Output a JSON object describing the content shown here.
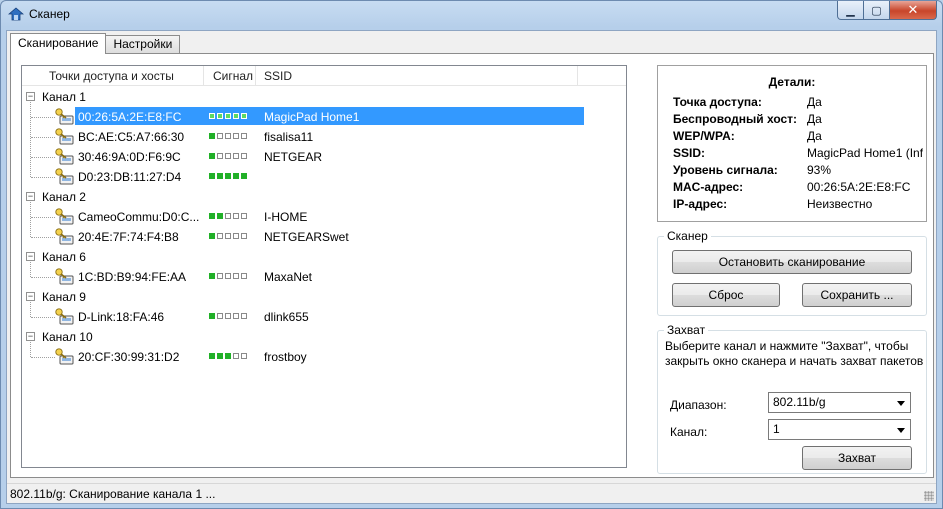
{
  "window": {
    "title": "Сканер",
    "controls": {
      "minimize_icon": "minimize-icon",
      "maximize_icon": "maximize-icon",
      "close_icon": "close-icon"
    }
  },
  "tabs": [
    {
      "label": "Сканирование",
      "active": true
    },
    {
      "label": "Настройки",
      "active": false
    }
  ],
  "tree": {
    "columns": [
      "Точки доступа и хосты",
      "Сигнал",
      "SSID"
    ],
    "channels": [
      {
        "label": "Канал 1",
        "hosts": [
          {
            "mac": "00:26:5A:2E:E8:FC",
            "signal": 5,
            "ssid": "MagicPad Home1",
            "selected": true
          },
          {
            "mac": "BC:AE:C5:A7:66:30",
            "signal": 1,
            "ssid": "fisalisa11",
            "selected": false
          },
          {
            "mac": "30:46:9A:0D:F6:9C",
            "signal": 1,
            "ssid": "NETGEAR",
            "selected": false
          },
          {
            "mac": "D0:23:DB:11:27:D4",
            "signal": 5,
            "ssid": "",
            "selected": false
          }
        ]
      },
      {
        "label": "Канал 2",
        "hosts": [
          {
            "mac": "CameoCommu:D0:C...",
            "signal": 2,
            "ssid": "I-HOME",
            "selected": false
          },
          {
            "mac": "20:4E:7F:74:F4:B8",
            "signal": 1,
            "ssid": "NETGEARSwet",
            "selected": false
          }
        ]
      },
      {
        "label": "Канал 6",
        "hosts": [
          {
            "mac": "1C:BD:B9:94:FE:AA",
            "signal": 1,
            "ssid": "MaxaNet",
            "selected": false
          }
        ]
      },
      {
        "label": "Канал 9",
        "hosts": [
          {
            "mac": "D-Link:18:FA:46",
            "signal": 1,
            "ssid": "dlink655",
            "selected": false
          }
        ]
      },
      {
        "label": "Канал 10",
        "hosts": [
          {
            "mac": "20:CF:30:99:31:D2",
            "signal": 3,
            "ssid": "frostboy",
            "selected": false
          }
        ]
      }
    ],
    "signal_max": 5,
    "colors": {
      "signal_on": "#21b028",
      "selection": "#3399ff"
    }
  },
  "details": {
    "title": "Детали:",
    "rows": [
      {
        "label": "Точка доступа:",
        "value": "Да"
      },
      {
        "label": "Беспроводный хост:",
        "value": "Да"
      },
      {
        "label": "WEP/WPA:",
        "value": "Да"
      },
      {
        "label": "SSID:",
        "value": "MagicPad Home1 (Inf"
      },
      {
        "label": "Уровень сигнала:",
        "value": "93%"
      },
      {
        "label": "MAC-адрес:",
        "value": "00:26:5A:2E:E8:FC"
      },
      {
        "label": "IP-адрес:",
        "value": "Неизвестно"
      }
    ]
  },
  "scanner": {
    "title": "Сканер",
    "stop_label": "Остановить сканирование",
    "reset_label": "Сброс",
    "save_label": "Сохранить ..."
  },
  "capture": {
    "title": "Захват",
    "instructions": "Выберите канал и нажмите \"Захват\", чтобы закрыть окно сканера и начать захват пакетов",
    "range_label": "Диапазон:",
    "range_value": "802.11b/g",
    "channel_label": "Канал:",
    "channel_value": "1",
    "capture_label": "Захват"
  },
  "status": {
    "text": "802.11b/g: Сканирование канала 1 ..."
  }
}
